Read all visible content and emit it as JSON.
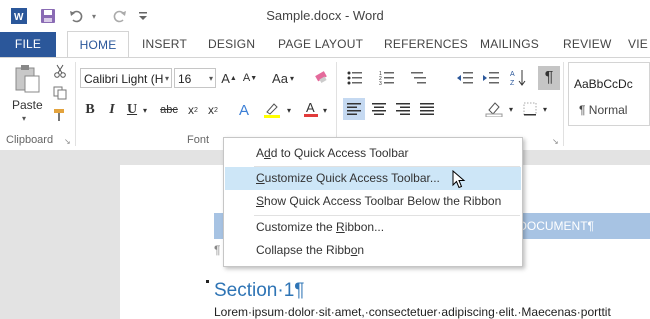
{
  "window": {
    "title": "Sample.docx - Word"
  },
  "qat": {
    "save_tip": "Save",
    "undo_tip": "Undo",
    "redo_tip": "Redo"
  },
  "tabs": [
    "FILE",
    "HOME",
    "INSERT",
    "DESIGN",
    "PAGE LAYOUT",
    "REFERENCES",
    "MAILINGS",
    "REVIEW",
    "VIE"
  ],
  "ribbon": {
    "clipboard": {
      "paste_label": "Paste",
      "group_label": "Clipboard"
    },
    "font": {
      "font_name": "Calibri Light (H",
      "font_size": "16",
      "group_label": "Font",
      "change_case": "Aa"
    },
    "styles": {
      "preview": "AaBbCcDc",
      "style_name": "¶ Normal"
    }
  },
  "context_menu": {
    "items": [
      {
        "pre": "A",
        "ul": "d",
        "post": "d to Quick Access Toolbar"
      },
      {
        "pre": "",
        "ul": "C",
        "post": "ustomize Quick Access Toolbar..."
      },
      {
        "pre": "",
        "ul": "S",
        "post": "how Quick Access Toolbar Below the Ribbon"
      },
      {
        "pre": "Customize the ",
        "ul": "R",
        "post": "ibbon..."
      },
      {
        "pre": "Collapse the Ribb",
        "ul": "o",
        "post": "n"
      }
    ]
  },
  "document": {
    "heading_band": "DOCUMENT¶",
    "pilcrow": "¶",
    "section_title": "Section·1¶",
    "body": "Lorem·ipsum·dolor·sit·amet,·consectetuer·adipiscing·elit.·Maecenas·porttit"
  },
  "colors": {
    "accent": "#2b579a",
    "hover": "#cde6f7",
    "heading": "#2e74b5",
    "band": "#a7c3e3"
  }
}
